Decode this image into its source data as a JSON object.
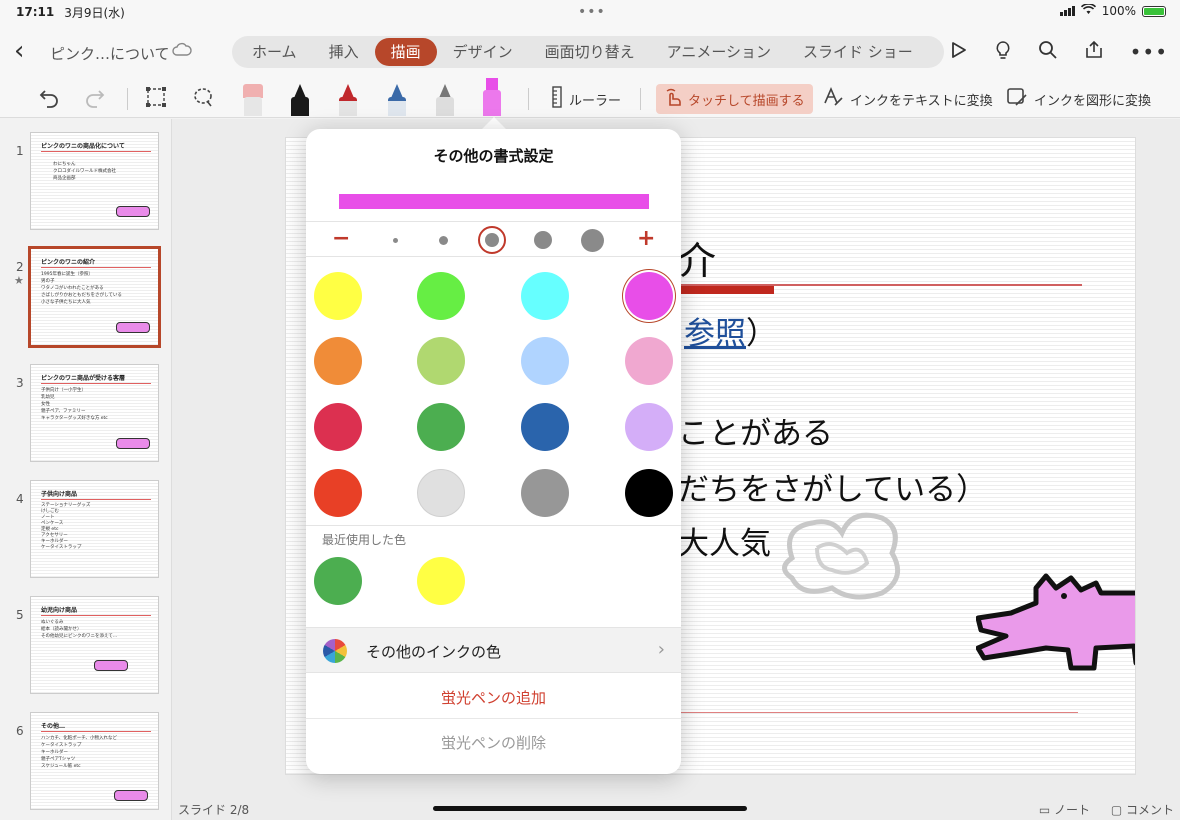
{
  "status": {
    "time": "17:11",
    "date": "3月9日(水)",
    "battery": "100%"
  },
  "header": {
    "doc_title": "ピンク…について",
    "tabs": [
      "ホーム",
      "挿入",
      "描画",
      "デザイン",
      "画面切り替え",
      "アニメーション",
      "スライド ショー"
    ],
    "active_tab": "描画"
  },
  "toolbar": {
    "ruler": "ルーラー",
    "touch_draw": "タッチして描画する",
    "ink_to_text": "インクをテキストに変換",
    "ink_to_shape": "インクを図形に変換",
    "pens": [
      {
        "name": "eraser",
        "color": "#f0b0b0"
      },
      {
        "name": "pen-black",
        "color": "#1a1a1a"
      },
      {
        "name": "pen-red",
        "color": "#c0282c"
      },
      {
        "name": "pencil-blue",
        "color": "#3b6aa8"
      },
      {
        "name": "pen-gray",
        "color": "#777777"
      },
      {
        "name": "highlighter-pink",
        "color": "#e84ee8"
      }
    ]
  },
  "thumbnails": [
    {
      "num": "1",
      "title": "ピンクのワニの商品化について",
      "items": [
        "わにちゃん",
        "クロコダイルワールド株式会社",
        "商品企画部"
      ]
    },
    {
      "num": "2",
      "title": "ピンクのワニの紹介",
      "items": [
        "1995年春に誕生（参照）",
        "男の子",
        "ワタノコがいわれたことがある",
        "さばしがりかおともだちをさがしている",
        "小さな子供たちに大人気"
      ]
    },
    {
      "num": "3",
      "title": "ピンクのワニ商品が受ける客層",
      "items": [
        "子供向け（一小学生）",
        "乳幼児",
        "女性",
        "親子ペア、ファミリー",
        "キャラクターグッズ好きな方 etc"
      ]
    },
    {
      "num": "4",
      "title": "子供向け商品",
      "items": [
        "ステーショナリーグッズ",
        "けしごむ",
        "ノート",
        "ペンケース",
        "定規 etc",
        "アクセサリー",
        "キーホルダー",
        "ケータイストラップ"
      ]
    },
    {
      "num": "5",
      "title": "幼児向け商品",
      "items": [
        "ぬいぐるみ",
        "絵本（読み聞かせ）",
        "その他幼児にピンクのワニを添えて…"
      ]
    },
    {
      "num": "6",
      "title": "その他…",
      "items": [
        "ハンカチ、化粧ポーチ、小物入れなど",
        "ケータイストラップ",
        "キーホルダー",
        "親子ペアTシャツ",
        "スケジュール帳 etc"
      ]
    }
  ],
  "selected_slide": "2",
  "slide": {
    "title_fragment": "介",
    "line1_link": "参照",
    "line1_tail": "）",
    "line2": "ことがある",
    "line3": "だちをさがしている）",
    "line4": "大人気"
  },
  "bottom": {
    "slide_counter": "スライド 2/8",
    "notes": "ノート",
    "comments": "コメント"
  },
  "popover": {
    "title": "その他の書式設定",
    "preview_color": "#e84ee8",
    "minus": "−",
    "plus": "+",
    "sizes": [
      1,
      2,
      3,
      4,
      5
    ],
    "selected_size_index": 2,
    "colors": [
      "#ffff44",
      "#66ee44",
      "#66ffff",
      "#e84ee8",
      "#f08c38",
      "#b0d870",
      "#b0d4ff",
      "#f0a8d0",
      "#dc3050",
      "#4cae50",
      "#2a64ac",
      "#d4aef8",
      "#e84026",
      "#e0e0e0",
      "#979797",
      "#000000"
    ],
    "selected_color": "#e84ee8",
    "recent_label": "最近使用した色",
    "recent_colors": [
      "#4cae50",
      "#ffff44"
    ],
    "more_colors": "その他のインクの色",
    "add_highlighter": "蛍光ペンの追加",
    "delete_highlighter": "蛍光ペンの削除"
  }
}
